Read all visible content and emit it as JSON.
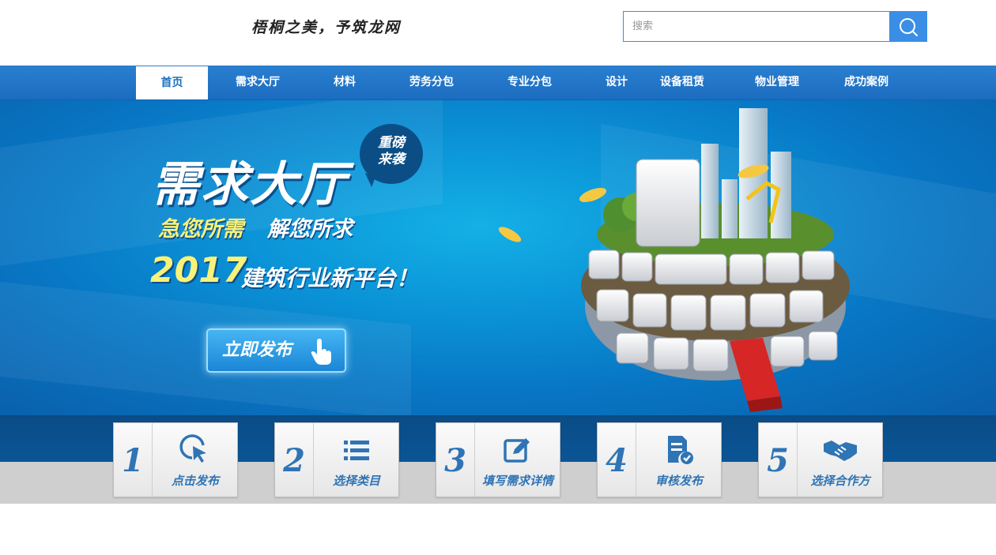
{
  "header": {
    "slogan": "梧桐之美，予筑龙网",
    "search": {
      "placeholder": "搜索",
      "value": ""
    }
  },
  "nav": {
    "items": [
      {
        "label": "首页",
        "active": true
      },
      {
        "label": "需求大厅"
      },
      {
        "label": "材料"
      },
      {
        "label": "劳务分包"
      },
      {
        "label": "专业分包"
      },
      {
        "label": "设计"
      },
      {
        "label": "设备租赁"
      },
      {
        "label": "物业管理"
      },
      {
        "label": "成功案例"
      }
    ]
  },
  "banner": {
    "title": "需求大厅",
    "badge_line1": "重磅",
    "badge_line2": "来袭",
    "slogan1": "急您所需",
    "slogan2": "解您所求",
    "year": "2017",
    "platform": "建筑行业新平台！",
    "cta_label": "立即发布"
  },
  "steps": [
    {
      "number": "1",
      "label": "点击发布",
      "icon": "cursor-click-icon"
    },
    {
      "number": "2",
      "label": "选择类目",
      "icon": "list-icon"
    },
    {
      "number": "3",
      "label": "填写需求详情",
      "icon": "edit-icon"
    },
    {
      "number": "4",
      "label": "审核发布",
      "icon": "document-check-icon"
    },
    {
      "number": "5",
      "label": "选择合作方",
      "icon": "handshake-icon"
    }
  ],
  "colors": {
    "accent": "#3a8ee6",
    "nav_bg": "#1d6fc3",
    "step_text": "#2f74b5",
    "highlight_yellow": "#f7f27a"
  }
}
